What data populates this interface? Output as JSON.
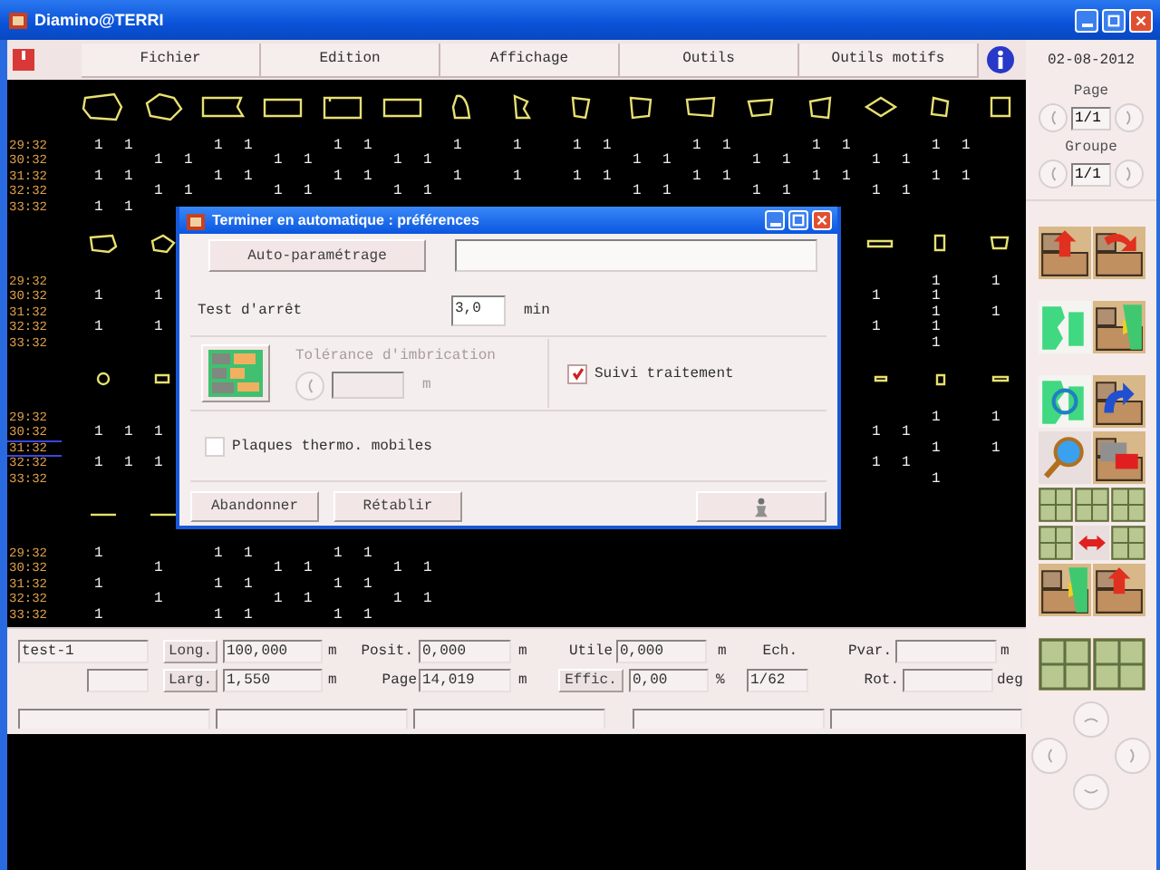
{
  "window": {
    "title": "Diamino@TERRI"
  },
  "menu": [
    {
      "label": "Fichier"
    },
    {
      "label": "Edition"
    },
    {
      "label": "Affichage"
    },
    {
      "label": "Outils"
    },
    {
      "label": "Outils motifs"
    }
  ],
  "date": "02-08-2012",
  "canvas": {
    "blocks": [
      {
        "rows": [
          {
            "time": "29:32",
            "marked": false,
            "cells": [
              {
                "kind": "count",
                "value": "1"
              },
              {
                "kind": "count",
                "value": "1"
              },
              {
                "kind": "gap"
              },
              {
                "kind": "gap"
              },
              {
                "kind": "count",
                "value": "1"
              },
              {
                "kind": "count",
                "value": "1"
              },
              {
                "kind": "gap"
              },
              {
                "kind": "gap"
              },
              {
                "kind": "count",
                "value": "1"
              },
              {
                "kind": "count",
                "value": "1"
              },
              {
                "kind": "gap"
              },
              {
                "kind": "gap"
              },
              {
                "kind": "count",
                "value": "1"
              },
              {
                "kind": "gap"
              },
              {
                "kind": "count",
                "value": "1"
              },
              {
                "kind": "gap"
              },
              {
                "kind": "count",
                "value": "1"
              },
              {
                "kind": "count",
                "value": "1"
              },
              {
                "kind": "gap"
              },
              {
                "kind": "gap"
              },
              {
                "kind": "count",
                "value": "1"
              },
              {
                "kind": "count",
                "value": "1"
              },
              {
                "kind": "gap"
              },
              {
                "kind": "gap"
              },
              {
                "kind": "count",
                "value": "1"
              },
              {
                "kind": "count",
                "value": "1"
              },
              {
                "kind": "gap"
              },
              {
                "kind": "gap"
              },
              {
                "kind": "count",
                "value": "1"
              },
              {
                "kind": "count",
                "value": "1"
              }
            ]
          },
          {
            "time": "30:32",
            "marked": false,
            "cells": [
              {
                "kind": "gap"
              },
              {
                "kind": "gap"
              },
              {
                "kind": "count",
                "value": "1"
              },
              {
                "kind": "count",
                "value": "1"
              },
              {
                "kind": "gap"
              },
              {
                "kind": "gap"
              },
              {
                "kind": "count",
                "value": "1"
              },
              {
                "kind": "count",
                "value": "1"
              },
              {
                "kind": "gap"
              },
              {
                "kind": "gap"
              },
              {
                "kind": "count",
                "value": "1"
              },
              {
                "kind": "count",
                "value": "1"
              },
              {
                "kind": "gap"
              },
              {
                "kind": "gap"
              },
              {
                "kind": "gap"
              },
              {
                "kind": "gap"
              },
              {
                "kind": "gap"
              },
              {
                "kind": "gap"
              },
              {
                "kind": "count",
                "value": "1"
              },
              {
                "kind": "count",
                "value": "1"
              },
              {
                "kind": "gap"
              },
              {
                "kind": "gap"
              },
              {
                "kind": "count",
                "value": "1"
              },
              {
                "kind": "count",
                "value": "1"
              },
              {
                "kind": "gap"
              },
              {
                "kind": "gap"
              },
              {
                "kind": "count",
                "value": "1"
              },
              {
                "kind": "count",
                "value": "1"
              }
            ]
          },
          {
            "time": "31:32",
            "marked": false,
            "cells": [
              {
                "kind": "count",
                "value": "1"
              },
              {
                "kind": "count",
                "value": "1"
              },
              {
                "kind": "gap"
              },
              {
                "kind": "gap"
              },
              {
                "kind": "count",
                "value": "1"
              },
              {
                "kind": "count",
                "value": "1"
              },
              {
                "kind": "gap"
              },
              {
                "kind": "gap"
              },
              {
                "kind": "count",
                "value": "1"
              },
              {
                "kind": "count",
                "value": "1"
              },
              {
                "kind": "gap"
              },
              {
                "kind": "gap"
              },
              {
                "kind": "count",
                "value": "1"
              },
              {
                "kind": "gap"
              },
              {
                "kind": "count",
                "value": "1"
              },
              {
                "kind": "gap"
              },
              {
                "kind": "count",
                "value": "1"
              },
              {
                "kind": "count",
                "value": "1"
              },
              {
                "kind": "gap"
              },
              {
                "kind": "gap"
              },
              {
                "kind": "count",
                "value": "1"
              },
              {
                "kind": "count",
                "value": "1"
              },
              {
                "kind": "gap"
              },
              {
                "kind": "gap"
              },
              {
                "kind": "count",
                "value": "1"
              },
              {
                "kind": "count",
                "value": "1"
              },
              {
                "kind": "gap"
              },
              {
                "kind": "gap"
              },
              {
                "kind": "count",
                "value": "1"
              },
              {
                "kind": "count",
                "value": "1"
              }
            ]
          },
          {
            "time": "32:32",
            "marked": false,
            "cells": [
              {
                "kind": "gap"
              },
              {
                "kind": "gap"
              },
              {
                "kind": "count",
                "value": "1"
              },
              {
                "kind": "count",
                "value": "1"
              },
              {
                "kind": "gap"
              },
              {
                "kind": "gap"
              },
              {
                "kind": "count",
                "value": "1"
              },
              {
                "kind": "count",
                "value": "1"
              },
              {
                "kind": "gap"
              },
              {
                "kind": "gap"
              },
              {
                "kind": "count",
                "value": "1"
              },
              {
                "kind": "count",
                "value": "1"
              },
              {
                "kind": "gap"
              },
              {
                "kind": "gap"
              },
              {
                "kind": "gap"
              },
              {
                "kind": "gap"
              },
              {
                "kind": "gap"
              },
              {
                "kind": "gap"
              },
              {
                "kind": "count",
                "value": "1"
              },
              {
                "kind": "count",
                "value": "1"
              },
              {
                "kind": "gap"
              },
              {
                "kind": "gap"
              },
              {
                "kind": "count",
                "value": "1"
              },
              {
                "kind": "count",
                "value": "1"
              },
              {
                "kind": "gap"
              },
              {
                "kind": "gap"
              },
              {
                "kind": "count",
                "value": "1"
              },
              {
                "kind": "count",
                "value": "1"
              }
            ]
          },
          {
            "time": "33:32",
            "marked": false,
            "cells": [
              {
                "kind": "count",
                "value": "1"
              },
              {
                "kind": "count",
                "value": "1"
              }
            ]
          }
        ]
      },
      {
        "rows": [
          {
            "time": "29:32",
            "marked": false,
            "cells_right": [
              {
                "kind": "gap"
              },
              {
                "kind": "gap"
              },
              {
                "kind": "count",
                "value": "1"
              },
              {
                "kind": "gap"
              },
              {
                "kind": "count",
                "value": "1"
              }
            ]
          },
          {
            "time": "30:32",
            "marked": false,
            "cells": [
              {
                "kind": "count",
                "value": "1"
              },
              {
                "kind": "gap"
              },
              {
                "kind": "count",
                "value": "1"
              }
            ],
            "cells_right": [
              {
                "kind": "count",
                "value": "1"
              },
              {
                "kind": "gap"
              },
              {
                "kind": "count",
                "value": "1"
              }
            ]
          },
          {
            "time": "31:32",
            "marked": false,
            "cells_right": [
              {
                "kind": "gap"
              },
              {
                "kind": "gap"
              },
              {
                "kind": "count",
                "value": "1"
              },
              {
                "kind": "gap"
              },
              {
                "kind": "count",
                "value": "1"
              }
            ]
          },
          {
            "time": "32:32",
            "marked": false,
            "cells": [
              {
                "kind": "count",
                "value": "1"
              },
              {
                "kind": "gap"
              },
              {
                "kind": "count",
                "value": "1"
              }
            ],
            "cells_right": [
              {
                "kind": "count",
                "value": "1"
              },
              {
                "kind": "gap"
              },
              {
                "kind": "count",
                "value": "1"
              }
            ]
          },
          {
            "time": "33:32",
            "marked": false,
            "cells_right": [
              {
                "kind": "gap"
              },
              {
                "kind": "gap"
              },
              {
                "kind": "count",
                "value": "1"
              }
            ]
          }
        ]
      },
      {
        "rows": [
          {
            "time": "29:32",
            "marked": false,
            "cells_right": [
              {
                "kind": "gap"
              },
              {
                "kind": "gap"
              },
              {
                "kind": "count",
                "value": "1"
              },
              {
                "kind": "gap"
              },
              {
                "kind": "count",
                "value": "1"
              }
            ]
          },
          {
            "time": "30:32",
            "marked": true,
            "cells": [
              {
                "kind": "count",
                "value": "1"
              },
              {
                "kind": "count",
                "value": "1"
              },
              {
                "kind": "count",
                "value": "1"
              }
            ],
            "cells_right": [
              {
                "kind": "count",
                "value": "1"
              },
              {
                "kind": "count",
                "value": "1"
              }
            ]
          },
          {
            "time": "31:32",
            "marked": true,
            "cells_right": [
              {
                "kind": "gap"
              },
              {
                "kind": "gap"
              },
              {
                "kind": "count",
                "value": "1"
              },
              {
                "kind": "gap"
              },
              {
                "kind": "count",
                "value": "1"
              }
            ]
          },
          {
            "time": "32:32",
            "marked": false,
            "cells": [
              {
                "kind": "count",
                "value": "1"
              },
              {
                "kind": "count",
                "value": "1"
              },
              {
                "kind": "count",
                "value": "1"
              }
            ],
            "cells_right": [
              {
                "kind": "count",
                "value": "1"
              },
              {
                "kind": "count",
                "value": "1"
              }
            ]
          },
          {
            "time": "33:32",
            "marked": false,
            "cells_right": [
              {
                "kind": "gap"
              },
              {
                "kind": "gap"
              },
              {
                "kind": "count",
                "value": "1"
              }
            ]
          }
        ]
      },
      {
        "rows": [
          {
            "time": "29:32",
            "marked": false,
            "cells": [
              {
                "kind": "count",
                "value": "1"
              },
              {
                "kind": "gap"
              },
              {
                "kind": "gap"
              },
              {
                "kind": "gap"
              },
              {
                "kind": "count",
                "value": "1"
              },
              {
                "kind": "count",
                "value": "1"
              },
              {
                "kind": "gap"
              },
              {
                "kind": "gap"
              },
              {
                "kind": "count",
                "value": "1"
              },
              {
                "kind": "count",
                "value": "1"
              }
            ]
          },
          {
            "time": "30:32",
            "marked": false,
            "cells": [
              {
                "kind": "gap"
              },
              {
                "kind": "gap"
              },
              {
                "kind": "count",
                "value": "1"
              },
              {
                "kind": "gap"
              },
              {
                "kind": "gap"
              },
              {
                "kind": "gap"
              },
              {
                "kind": "count",
                "value": "1"
              },
              {
                "kind": "count",
                "value": "1"
              },
              {
                "kind": "gap"
              },
              {
                "kind": "gap"
              },
              {
                "kind": "count",
                "value": "1"
              },
              {
                "kind": "count",
                "value": "1"
              }
            ]
          },
          {
            "time": "31:32",
            "marked": false,
            "cells": [
              {
                "kind": "count",
                "value": "1"
              },
              {
                "kind": "gap"
              },
              {
                "kind": "gap"
              },
              {
                "kind": "gap"
              },
              {
                "kind": "count",
                "value": "1"
              },
              {
                "kind": "count",
                "value": "1"
              },
              {
                "kind": "gap"
              },
              {
                "kind": "gap"
              },
              {
                "kind": "count",
                "value": "1"
              },
              {
                "kind": "count",
                "value": "1"
              }
            ]
          },
          {
            "time": "32:32",
            "marked": false,
            "cells": [
              {
                "kind": "gap"
              },
              {
                "kind": "gap"
              },
              {
                "kind": "count",
                "value": "1"
              },
              {
                "kind": "gap"
              },
              {
                "kind": "gap"
              },
              {
                "kind": "gap"
              },
              {
                "kind": "count",
                "value": "1"
              },
              {
                "kind": "count",
                "value": "1"
              },
              {
                "kind": "gap"
              },
              {
                "kind": "gap"
              },
              {
                "kind": "count",
                "value": "1"
              },
              {
                "kind": "count",
                "value": "1"
              }
            ]
          },
          {
            "time": "33:32",
            "marked": false,
            "cells": [
              {
                "kind": "count",
                "value": "1"
              },
              {
                "kind": "gap"
              },
              {
                "kind": "gap"
              },
              {
                "kind": "gap"
              },
              {
                "kind": "count",
                "value": "1"
              },
              {
                "kind": "count",
                "value": "1"
              },
              {
                "kind": "gap"
              },
              {
                "kind": "gap"
              },
              {
                "kind": "count",
                "value": "1"
              },
              {
                "kind": "count",
                "value": "1"
              }
            ]
          }
        ]
      }
    ]
  },
  "bottom_panel": {
    "rows": [
      [
        {
          "kind": "field",
          "value": "test-1"
        },
        {
          "kind": "button",
          "label": "Long."
        },
        {
          "kind": "field",
          "value": "100,000"
        },
        {
          "kind": "unit",
          "label": "m"
        },
        {
          "kind": "label",
          "label": "Posit."
        },
        {
          "kind": "field",
          "value": "0,000"
        },
        {
          "kind": "unit",
          "label": "m"
        },
        {
          "kind": "label",
          "label": "Utile"
        },
        {
          "kind": "field",
          "value": "0,000"
        },
        {
          "kind": "unit",
          "label": "m"
        },
        {
          "kind": "label",
          "label": "Ech."
        },
        {
          "kind": "label",
          "label": "Pvar."
        },
        {
          "kind": "field"
        },
        {
          "kind": "unit",
          "label": "m"
        }
      ],
      [
        {
          "kind": "field"
        },
        {
          "kind": "button",
          "label": "Larg."
        },
        {
          "kind": "field",
          "value": "1,550"
        },
        {
          "kind": "unit",
          "label": "m"
        },
        {
          "kind": "label",
          "label": "Page"
        },
        {
          "kind": "field",
          "value": "14,019"
        },
        {
          "kind": "unit",
          "label": "m"
        },
        {
          "kind": "button",
          "label": "Effic."
        },
        {
          "kind": "field",
          "value": "0,00"
        },
        {
          "kind": "unit",
          "label": "%"
        },
        {
          "kind": "field",
          "value": "1/62"
        },
        {
          "kind": "label",
          "label": "Rot."
        },
        {
          "kind": "field"
        },
        {
          "kind": "unit",
          "label": "deg"
        }
      ]
    ]
  },
  "side_panel": {
    "page": {
      "label": "Page",
      "value": "1/1"
    },
    "group": {
      "label": "Groupe",
      "value": "1/1"
    }
  },
  "dialog": {
    "title": "Terminer en automatique : préférences",
    "auto_button": "Auto-paramétrage",
    "stop_test": {
      "label": "Test d'arrêt",
      "value": "3,0",
      "unit": "min"
    },
    "tolerance": {
      "label": "Tolérance d'imbrication",
      "unit": "m",
      "disabled": true
    },
    "checkboxes": [
      {
        "label": "Suivi traitement",
        "checked": true
      },
      {
        "label": "Plaques thermo. mobiles",
        "checked": false
      }
    ],
    "buttons": [
      {
        "label": "Abandonner"
      },
      {
        "label": "Rétablir"
      }
    ]
  }
}
